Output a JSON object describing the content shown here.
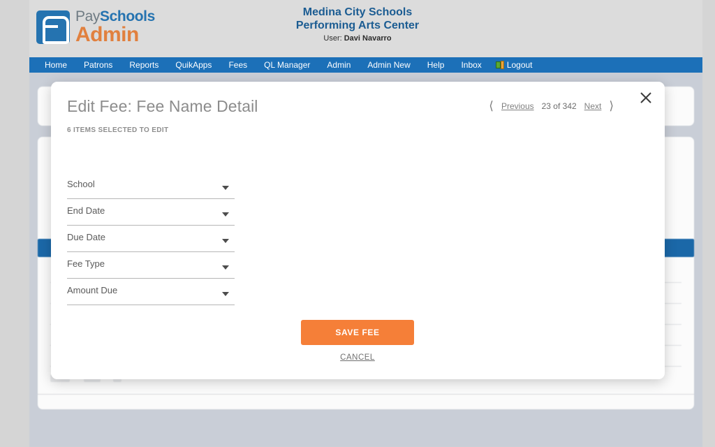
{
  "brand": {
    "logo_line1_a": "Pay",
    "logo_line1_b": "Schools",
    "logo_line2": "Admin",
    "logo_icon": "payschools-logo-icon"
  },
  "header": {
    "title_line1": "Medina City Schools",
    "title_line2": "Performing Arts Center",
    "user_label": "User:",
    "user_name": "Davi Navarro"
  },
  "nav": {
    "items": [
      {
        "label": "Home"
      },
      {
        "label": "Patrons"
      },
      {
        "label": "Reports"
      },
      {
        "label": "QuikApps"
      },
      {
        "label": "Fees"
      },
      {
        "label": "QL Manager"
      },
      {
        "label": "Admin"
      },
      {
        "label": "Admin New"
      },
      {
        "label": "Help"
      },
      {
        "label": "Inbox"
      }
    ],
    "logout_label": "Logout",
    "logout_icon": "logout-door-icon",
    "background_color": "#1c70b8"
  },
  "modal": {
    "title": "Edit Fee: Fee Name Detail",
    "subtitle": "6 ITEMS SELECTED TO EDIT",
    "close_icon": "close-x-icon",
    "pager": {
      "prev_icon": "chevron-left-icon",
      "prev_label": "Previous",
      "count_label": "23 of 342",
      "next_label": "Next",
      "next_icon": "chevron-right-icon"
    },
    "fields": [
      {
        "label": "School",
        "value": "",
        "caret_icon": "chevron-down-icon"
      },
      {
        "label": "End Date",
        "value": "",
        "caret_icon": "chevron-down-icon"
      },
      {
        "label": "Due Date",
        "value": "",
        "caret_icon": "chevron-down-icon"
      },
      {
        "label": "Fee Type",
        "value": "",
        "caret_icon": "chevron-down-icon"
      },
      {
        "label": "Amount Due",
        "value": "",
        "caret_icon": "chevron-down-icon"
      }
    ],
    "save_label": "SAVE FEE",
    "save_color": "#f57f38",
    "cancel_label": "CANCEL"
  }
}
